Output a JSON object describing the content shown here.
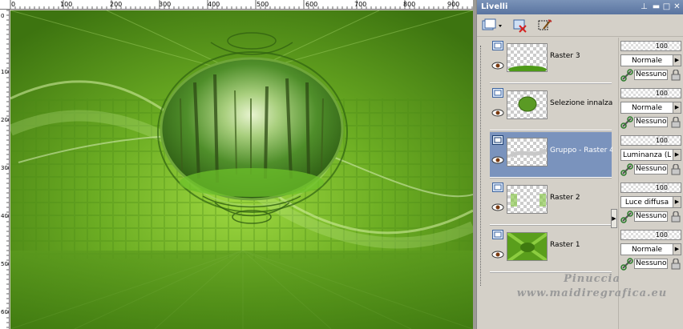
{
  "ruler": {
    "top_labels": [
      "0",
      "100",
      "200",
      "300",
      "400",
      "500",
      "600",
      "700",
      "800",
      "900"
    ],
    "left_labels": [
      "0",
      "100",
      "200",
      "300",
      "400",
      "500",
      "600"
    ]
  },
  "panel": {
    "title": "Livelli",
    "pin_glyph": "⊥",
    "minimize_glyph": "▬",
    "maximize_glyph": "□",
    "close_glyph": "✕"
  },
  "toolbar": {
    "icons": [
      "new-layer-icon",
      "delete-layer-icon",
      "edit-selection-icon"
    ]
  },
  "layers": [
    {
      "name": "Raster 3",
      "selected": false,
      "opacity": "100",
      "blend": "Normale",
      "mask": "Nessuno"
    },
    {
      "name": "Selezione innalzata",
      "selected": false,
      "opacity": "100",
      "blend": "Normale",
      "mask": "Nessuno"
    },
    {
      "name": "Gruppo - Raster 4",
      "selected": true,
      "opacity": "100",
      "blend": "Luminanza (L)",
      "mask": "Nessuno"
    },
    {
      "name": "Raster 2",
      "selected": false,
      "opacity": "100",
      "blend": "Luce diffusa",
      "mask": "Nessuno"
    },
    {
      "name": "Raster 1",
      "selected": false,
      "opacity": "100",
      "blend": "Normale",
      "mask": "Nessuno"
    }
  ],
  "expand_glyph": "▶",
  "dropdown_glyph": "▶",
  "watermark": {
    "line1": "Pinuccia",
    "line2": "www.maidiregrafica.eu"
  },
  "colors": {
    "selected_row": "#7a93bd",
    "titlebar": "#5a74a0",
    "canvas_green": "#6aac22"
  }
}
